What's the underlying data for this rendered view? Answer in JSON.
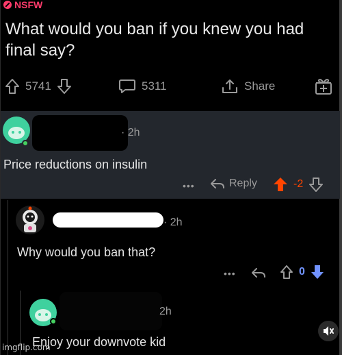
{
  "post": {
    "nsfw_label": "NSFW",
    "title": "What would you ban if you knew you had final say?",
    "upvotes": "5741",
    "comments": "5311",
    "share_label": "Share"
  },
  "comment1": {
    "time": "· 2h",
    "text": "Price reductions on insulin",
    "reply_label": "Reply",
    "score": "-2",
    "menu": "•••"
  },
  "comment2": {
    "time": "· 2h",
    "text": "Why would you ban that?",
    "score": "0",
    "menu": "•••"
  },
  "comment3": {
    "time": "2h",
    "text": "Enjoy your downvote kid"
  },
  "watermark": "imgflip.com",
  "colors": {
    "nsfw": "#ff3b6b",
    "upvote_active": "#ff4500",
    "downvote_active": "#7193ff",
    "highlight_bg": "#23272d"
  }
}
